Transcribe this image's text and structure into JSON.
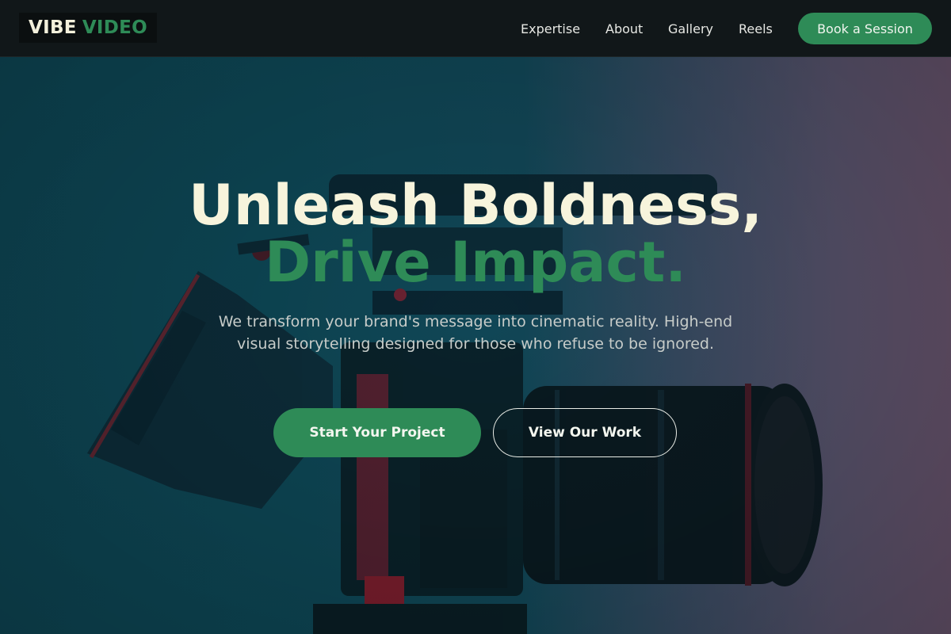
{
  "brand": {
    "name_part1": "VIBE",
    "name_part2": "VIDEO"
  },
  "nav": {
    "items": [
      {
        "label": "Expertise"
      },
      {
        "label": "About"
      },
      {
        "label": "Gallery"
      },
      {
        "label": "Reels"
      }
    ],
    "cta_label": "Book a Session"
  },
  "hero": {
    "headline_line1": "Unleash Boldness,",
    "headline_line2": "Drive Impact.",
    "subtitle": "We transform your brand's message into cinematic reality. High-end visual storytelling designed for those who refuse to be ignored.",
    "primary_cta": "Start Your Project",
    "secondary_cta": "View Our Work",
    "background_image": "cinema-camera-rig-photo"
  },
  "colors": {
    "accent": "#2e8b57",
    "headline": "#f7f4dc",
    "header_bg": "#111719"
  }
}
